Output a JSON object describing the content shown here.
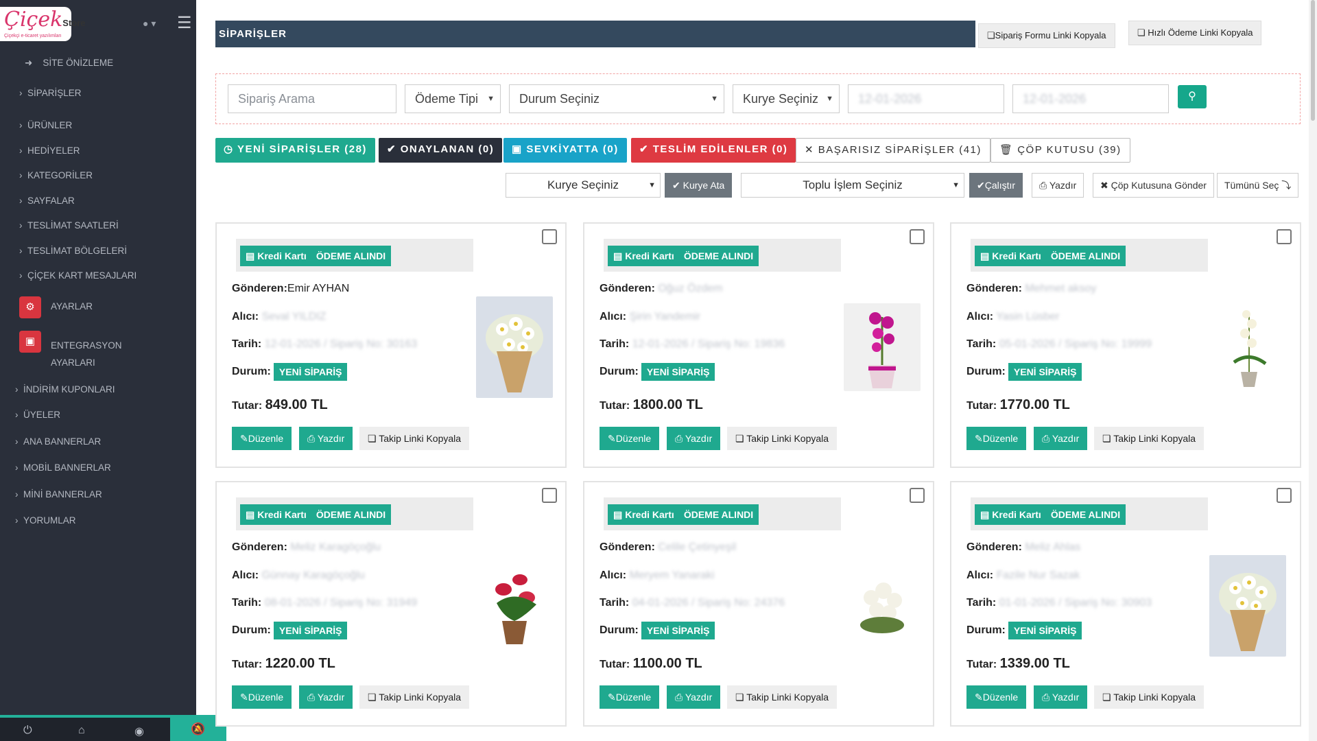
{
  "brand": {
    "logo_text": "Çiçek",
    "logo_suffix": "Store",
    "logo_tagline": "Çiçekçi e-ticaret yazılımları"
  },
  "sidebar": {
    "items": [
      {
        "label": "SİTE ÖNİZLEME",
        "icon": "sign-out-icon"
      },
      {
        "label": "SİPARİŞLER"
      },
      {
        "label": "ÜRÜNLER"
      },
      {
        "label": "HEDİYELER"
      },
      {
        "label": "KATEGORİLER"
      },
      {
        "label": "SAYFALAR"
      },
      {
        "label": "TESLİMAT SAATLERİ"
      },
      {
        "label": "TESLİMAT BÖLGELERİ"
      },
      {
        "label": "ÇİÇEK KART MESAJLARI"
      },
      {
        "label": "AYARLAR",
        "icon": "cogs-icon"
      },
      {
        "label": "ENTEGRASYON AYARLARI",
        "icon": "integration-icon"
      },
      {
        "label": "İNDİRİM KUPONLARI"
      },
      {
        "label": "ÜYELER"
      },
      {
        "label": "ANA BANNERLAR"
      },
      {
        "label": "MOBİL BANNERLAR"
      },
      {
        "label": "MİNİ BANNERLAR"
      },
      {
        "label": "YORUMLAR"
      }
    ],
    "bottom_icons": [
      "power-icon",
      "home-icon",
      "eye-icon",
      "bell-slash-icon"
    ]
  },
  "header": {
    "title": "SİPARİŞLER",
    "copy_form_link": "Sipariş Formu Linki Kopyala",
    "copy_payment_link": "Hızlı Ödeme Linki Kopyala"
  },
  "filters": {
    "search_placeholder": "Sipariş Arama",
    "payment_type": "Ödeme Tipi",
    "status": "Durum Seçiniz",
    "courier": "Kurye Seçiniz",
    "date_from": "12-01-2026",
    "date_to": "12-01-2026"
  },
  "tabs": [
    {
      "label": "YENİ SİPARİŞLER (28)",
      "icon": "clock-icon",
      "color": "#1fa98f"
    },
    {
      "label": "ONAYLANAN (0)",
      "icon": "check-icon",
      "color": "#2a2f3a"
    },
    {
      "label": "SEVKİYATTA (0)",
      "icon": "bus-icon",
      "color": "#19a3c8"
    },
    {
      "label": "TESLİM EDİLENLER (0)",
      "icon": "check-icon",
      "color": "#de3a42"
    },
    {
      "label": "BAŞARISIZ SİPARİŞLER (41)",
      "icon": "times-icon",
      "color": "#ffffff"
    },
    {
      "label": "ÇÖP KUTUSU (39)",
      "icon": "trash-icon",
      "color": "#ffffff"
    }
  ],
  "actions": {
    "courier_select": "Kurye Seçiniz",
    "assign_courier": "Kurye Ata",
    "bulk_select": "Toplu İşlem Seçiniz",
    "run": "Çalıştır",
    "print": "Yazdır",
    "send_trash": "Çöp Kutusuna Gönder",
    "select_all": "Tümünü Seç"
  },
  "labels": {
    "payment": "Kredi Kartı",
    "paid": "ÖDEME ALINDI",
    "sender": "Gönderen:",
    "recipient": "Alıcı:",
    "date": "Tarih:",
    "status": "Durum:",
    "amount": "Tutar:",
    "edit": "Düzenle",
    "print": "Yazdır",
    "track": "Takip Linki Kopyala",
    "new_order": "YENİ SİPARİŞ"
  },
  "orders": [
    {
      "sender": "Emir AYHAN",
      "recipient": "Seval YILDIZ",
      "date": "12-01-2026 / Sipariş No: 30163",
      "amount": "849.00 TL",
      "image": "daisy-bouquet"
    },
    {
      "sender": "Oğuz Özdem",
      "recipient": "Şirin Yandemir",
      "date": "12-01-2026 / Sipariş No: 19836",
      "amount": "1800.00 TL",
      "image": "pink-orchid"
    },
    {
      "sender": "Mehmet aksoy",
      "recipient": "Yasin Lüsber",
      "date": "05-01-2026 / Sipariş No: 19999",
      "amount": "1770.00 TL",
      "image": "white-orchid"
    },
    {
      "sender": "Meliz Karagöçoğlu",
      "recipient": "Günnay Karagöçoğlu",
      "date": "08-01-2026 / Sipariş No: 31949",
      "amount": "1220.00 TL",
      "image": "anthurium-pot"
    },
    {
      "sender": "Celile Çetinyeşil",
      "recipient": "Meryem Yanaraki",
      "date": "04-01-2026 / Sipariş No: 24376",
      "amount": "1100.00 TL",
      "image": "white-rose-box"
    },
    {
      "sender": "Meliz Ahlas",
      "recipient": "Fazile Nur Sazak",
      "date": "01-01-2026 / Sipariş No: 30903",
      "amount": "1339.00 TL",
      "image": "daisy-bouquet"
    }
  ]
}
